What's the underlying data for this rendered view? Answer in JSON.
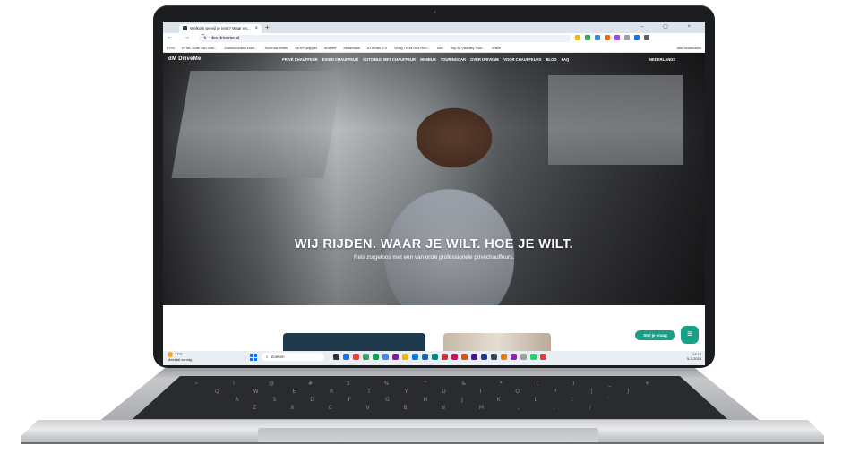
{
  "browser": {
    "tab_title": "Welkom terwijl je reist? Waar en...",
    "tab_close": "×",
    "new_tab": "+",
    "window_controls": "–  ▢  ×",
    "nav_buttons": "← → C",
    "url": "dev.driveme.nl",
    "bookmarks": [
      "EYM",
      "HTML code van vink...",
      "Zoekwoorden zoek...",
      "Schema tester",
      "SERP snippet",
      "dmeme",
      "MetaMask",
      "AI Writer 2.0",
      "Veilig Thuis met Ren...",
      "cwv",
      "Top AI Visibility Tool...",
      "dnwe"
    ],
    "bookmarks_right": "Alle bookmarks"
  },
  "site": {
    "logo": "dM DriveMe",
    "menu": [
      "PRIVÉ CHAUFFEUR",
      "EIGEN CHAUFFEUR",
      "AUTO/BUS MET CHAUFFEUR",
      "MINIBUS",
      "TOURINGCAR",
      "OVER DRIVEME",
      "VOOR CHAUFFEURS",
      "BLOG",
      "FAQ"
    ],
    "language": "NEDERLANDS",
    "headline": "WIJ RIJDEN. WAAR JE WILT. HOE JE WILT.",
    "subline": "Reis zorgeloos met een van onze professionele privéchauffeurs.",
    "chat_pill": "Stel je vraag",
    "chat_icon": "≡"
  },
  "taskbar": {
    "temperature": "17°C",
    "weather": "Meestal zonnig",
    "search_placeholder": "Zoeken",
    "time": "13:13",
    "date": "5-3-2026"
  },
  "colors": {
    "accent": "#16a085",
    "dark_card": "#1e3a4c",
    "taskbar": "#e9eef5"
  }
}
